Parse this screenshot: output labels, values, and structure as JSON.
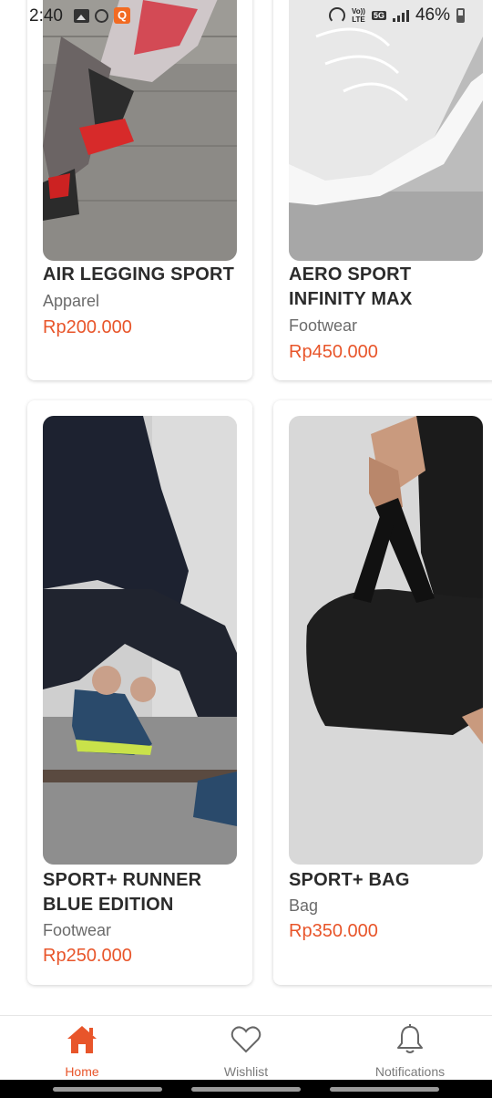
{
  "status_bar": {
    "time": "2:40",
    "network_top": "Vo))",
    "network_bottom": "LTE",
    "network_5g": "5G",
    "battery": "46%"
  },
  "products": [
    {
      "name": "AIR LEGGING SPORT",
      "category": "Apparel",
      "price": "Rp200.000",
      "image": "legging-runner-photo"
    },
    {
      "name": "AERO SPORT INFINITY MAX",
      "category": "Footwear",
      "price": "Rp450.000",
      "image": "white-sneaker-photo"
    },
    {
      "name": "SPORT+ RUNNER BLUE EDITION",
      "category": "Footwear",
      "price": "Rp250.000",
      "image": "runner-tying-shoe-photo"
    },
    {
      "name": "SPORT+ BAG",
      "category": "Bag",
      "price": "Rp350.000",
      "image": "gym-bag-photo"
    }
  ],
  "nav": {
    "items": [
      {
        "label": "Home",
        "icon": "home-icon",
        "active": true
      },
      {
        "label": "Wishlist",
        "icon": "heart-icon",
        "active": false
      },
      {
        "label": "Notifications",
        "icon": "bell-icon",
        "active": false
      }
    ]
  },
  "colors": {
    "accent": "#e8552a",
    "text": "#2b2b2b",
    "muted": "#6b6b6b"
  }
}
